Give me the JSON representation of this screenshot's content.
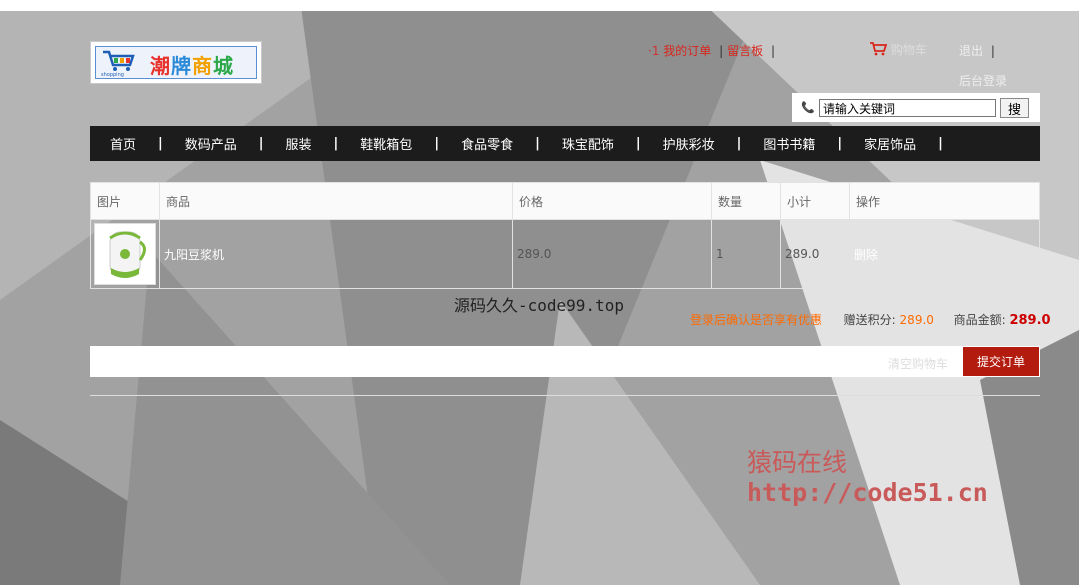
{
  "logo": {
    "text": [
      "潮",
      "牌",
      "商",
      "城"
    ],
    "sub": "shopping"
  },
  "toplinks": {
    "prefix": "·1",
    "orders": "我的订单",
    "guestbook": "留言板",
    "sep": "|",
    "cart": "购物车",
    "logout": "退出",
    "logout_sep": "|",
    "admin": "后台登录"
  },
  "search": {
    "value": "请输入关键词",
    "button": "搜"
  },
  "nav": [
    {
      "label": "首页"
    },
    {
      "label": "数码产品"
    },
    {
      "label": "服装"
    },
    {
      "label": "鞋靴箱包"
    },
    {
      "label": "食品零食"
    },
    {
      "label": "珠宝配饰"
    },
    {
      "label": "护肤彩妆"
    },
    {
      "label": "图书书籍"
    },
    {
      "label": "家居饰品"
    }
  ],
  "nav_sep": "|",
  "table": {
    "headers": [
      "图片",
      "商品",
      "价格",
      "数量",
      "小计",
      "操作"
    ],
    "rows": [
      {
        "name": "九阳豆浆机",
        "price": "289.0",
        "qty": "1",
        "subtotal": "289.0",
        "action": "删除"
      }
    ]
  },
  "summary": {
    "login_hint": "登录后确认是否享有优惠",
    "points_label": "赠送积分:",
    "points": "289.0",
    "amount_label": "商品金额:",
    "amount": "289.0"
  },
  "order": {
    "clear": "清空购物车",
    "submit": "提交订单"
  },
  "watermarks": {
    "source": "源码久久-code99.top",
    "line1": "猿码在线",
    "line2": "http://code51.cn"
  },
  "colors": {
    "nav_bg": "#1c1c1c",
    "accent_red": "#d8261c",
    "submit_bg": "#b31b0e",
    "orange": "#ff6a00"
  }
}
